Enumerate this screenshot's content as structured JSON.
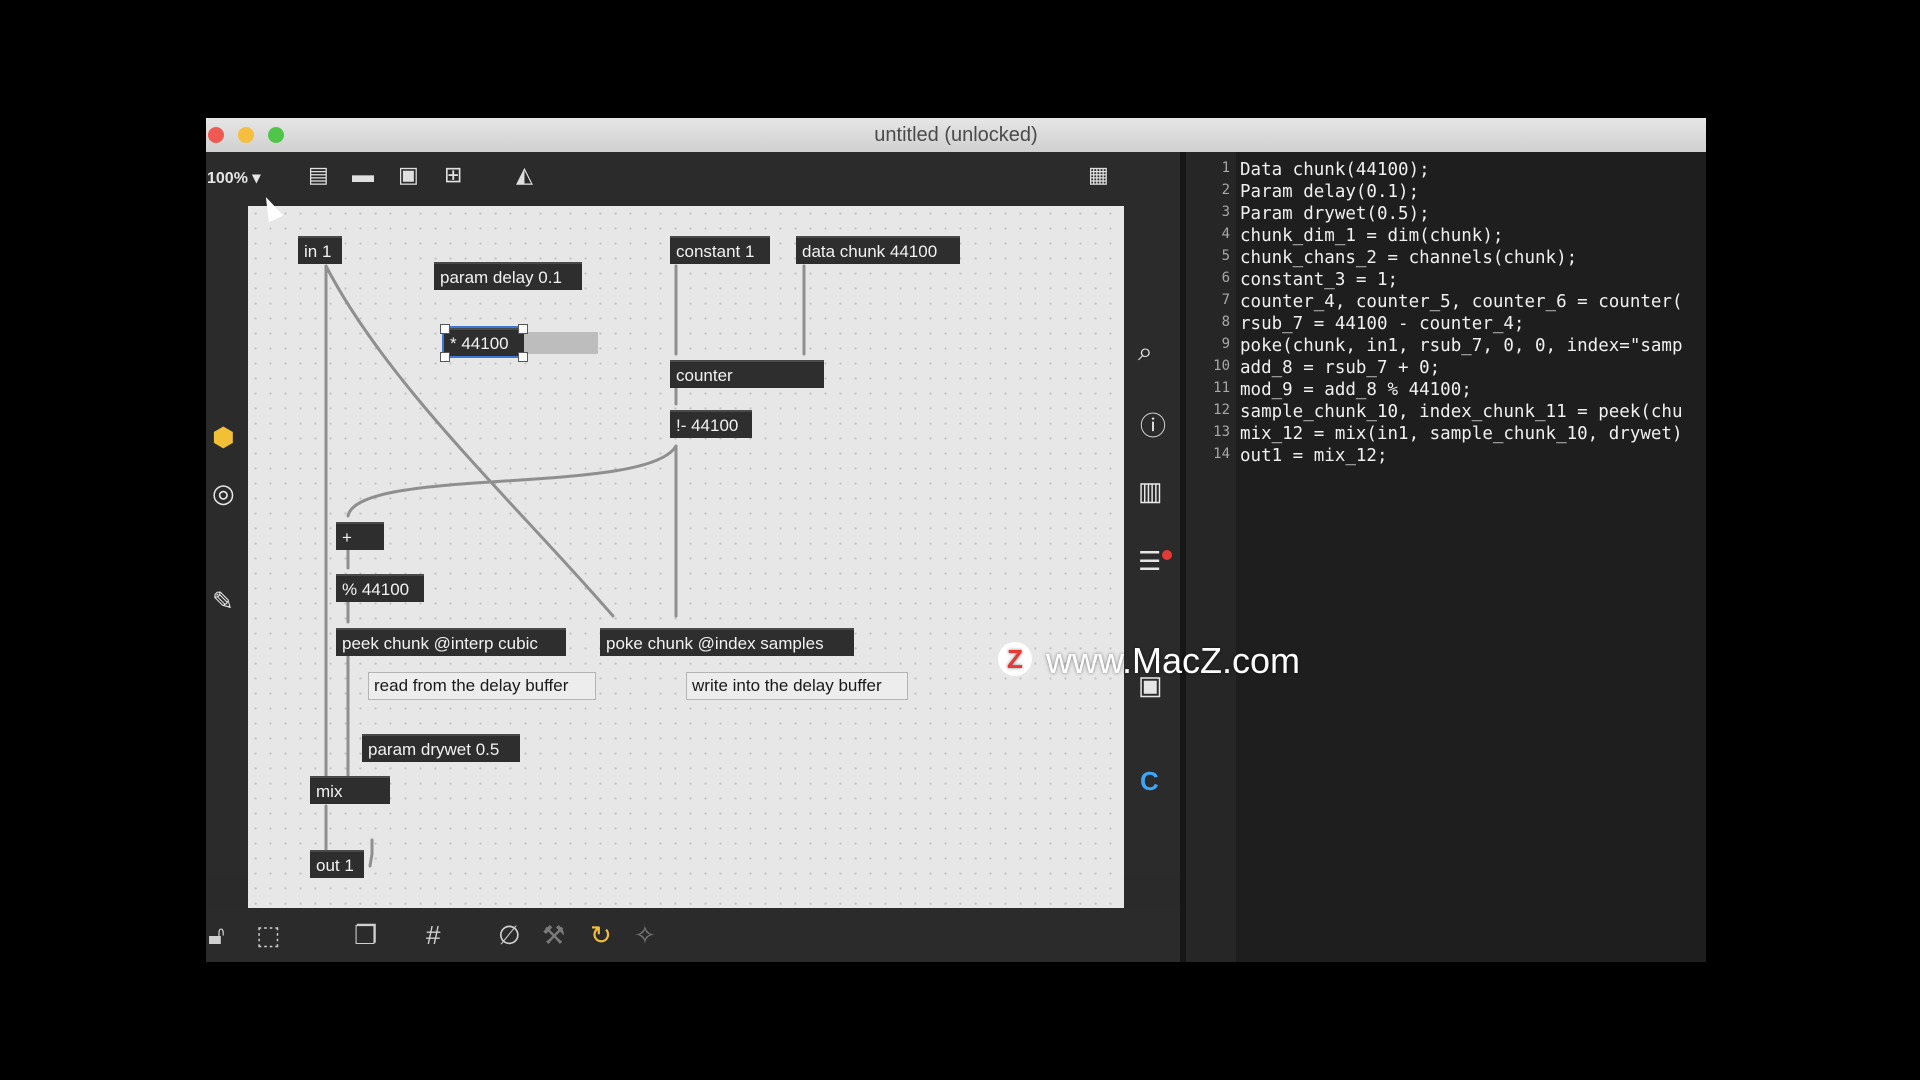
{
  "window": {
    "title": "untitled (unlocked)"
  },
  "toolbar": {
    "zoom": "100%",
    "icons": [
      "presentation-icon",
      "comment-icon",
      "fullscreen-icon",
      "codebox-icon",
      "paint-bucket-icon",
      "grid-icon"
    ]
  },
  "left_sidebar": {
    "icons": [
      "package-icon",
      "target-icon",
      "paperclip-icon"
    ]
  },
  "right_sidebar": {
    "icons": [
      "search-icon",
      "info-icon",
      "book-icon",
      "list-icon",
      "camera-icon",
      "c-icon"
    ]
  },
  "patch": {
    "objects": {
      "in1": "in 1",
      "param_delay": "param delay 0.1",
      "mult": "* 44100",
      "constant": "constant 1",
      "data_chunk": "data chunk 44100",
      "counter": "counter",
      "rsub": "!- 44100",
      "add": "+",
      "mod": "% 44100",
      "peek": "peek chunk @interp cubic",
      "poke": "poke chunk @index samples",
      "param_drywet": "param drywet 0.5",
      "mix": "mix",
      "out1": "out 1"
    },
    "comments": {
      "read": "read from the delay buffer",
      "write": "write into the delay buffer"
    }
  },
  "bottom_toolbar": {
    "icons": [
      "lock-icon",
      "select-icon",
      "layers-icon",
      "grid-icon",
      "mute-icon",
      "hammer-icon",
      "refresh-icon",
      "debug-icon"
    ]
  },
  "code": {
    "lines": [
      {
        "n": "1",
        "text": "Data chunk(44100);"
      },
      {
        "n": "2",
        "text": "Param delay(0.1);"
      },
      {
        "n": "3",
        "text": "Param drywet(0.5);"
      },
      {
        "n": "4",
        "text": "chunk_dim_1 = dim(chunk);"
      },
      {
        "n": "5",
        "text": "chunk_chans_2 = channels(chunk);"
      },
      {
        "n": "6",
        "text": "constant_3 = 1;"
      },
      {
        "n": "7",
        "text": "counter_4, counter_5, counter_6 = counter("
      },
      {
        "n": "8",
        "text": "rsub_7 = 44100 - counter_4;"
      },
      {
        "n": "9",
        "text": "poke(chunk, in1, rsub_7, 0, 0, index=\"samp"
      },
      {
        "n": "10",
        "text": "add_8 = rsub_7 + 0;"
      },
      {
        "n": "11",
        "text": "mod_9 = add_8 % 44100;"
      },
      {
        "n": "12",
        "text": "sample_chunk_10, index_chunk_11 = peek(chu"
      },
      {
        "n": "13",
        "text": "mix_12 = mix(in1, sample_chunk_10, drywet)"
      },
      {
        "n": "14",
        "text": "out1 = mix_12;"
      }
    ]
  },
  "watermark": {
    "logo": "Z",
    "text": "www.MacZ.com"
  },
  "colors": {
    "canvas": "#e7e7e7",
    "object_bg": "#2e2e2e",
    "selection": "#3c78d8",
    "code_bg": "#1e1e1e",
    "number_purple": "#b58cff",
    "keyword_blue": "#58a6ff"
  }
}
